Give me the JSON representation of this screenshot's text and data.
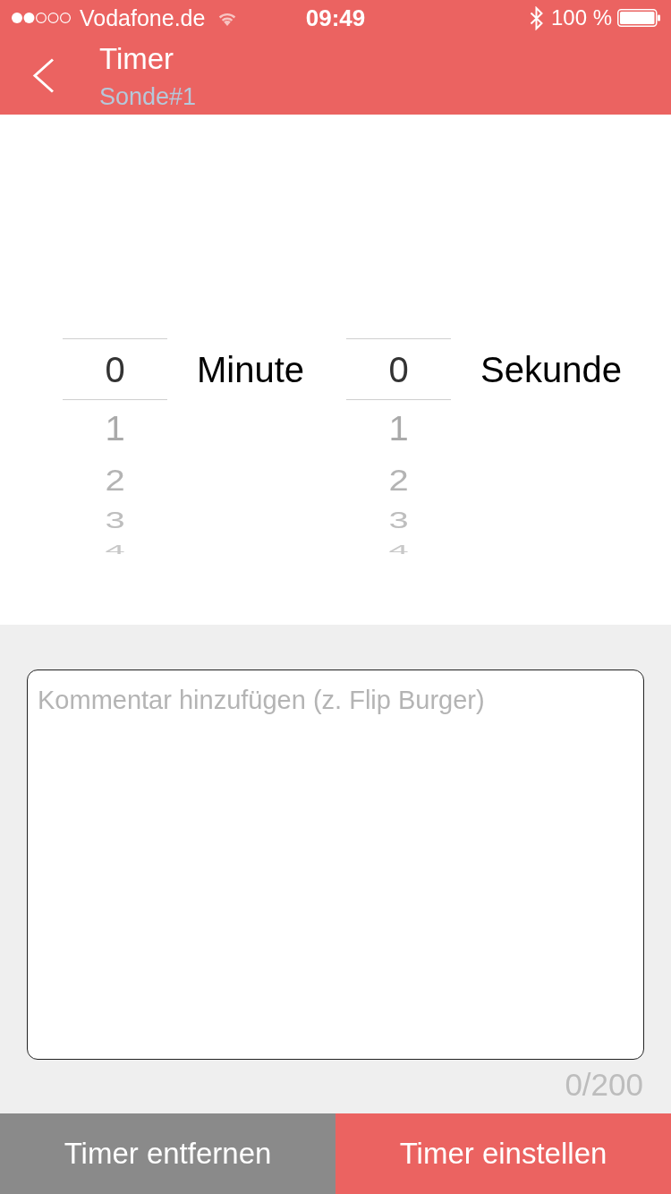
{
  "status_bar": {
    "carrier": "Vodafone.de",
    "time": "09:49",
    "battery": "100 %"
  },
  "header": {
    "title": "Timer",
    "subtitle": "Sonde#1"
  },
  "pickers": [
    {
      "unit": "Minute",
      "items": [
        {
          "label": "0",
          "selected": true
        },
        {
          "label": "1",
          "selected": false
        },
        {
          "label": "2",
          "selected": false
        },
        {
          "label": "3",
          "selected": false
        },
        {
          "label": "4",
          "selected": false
        }
      ]
    },
    {
      "unit": "Sekunde",
      "items": [
        {
          "label": "0",
          "selected": true
        },
        {
          "label": "1",
          "selected": false
        },
        {
          "label": "2",
          "selected": false
        },
        {
          "label": "3",
          "selected": false
        },
        {
          "label": "4",
          "selected": false
        }
      ]
    }
  ],
  "comment": {
    "placeholder": "Kommentar hinzufügen (z. Flip Burger)",
    "counter": "0/200"
  },
  "buttons": [
    {
      "label": "Timer entfernen",
      "kind": "secondary"
    },
    {
      "label": "Timer einstellen",
      "kind": "primary"
    }
  ]
}
